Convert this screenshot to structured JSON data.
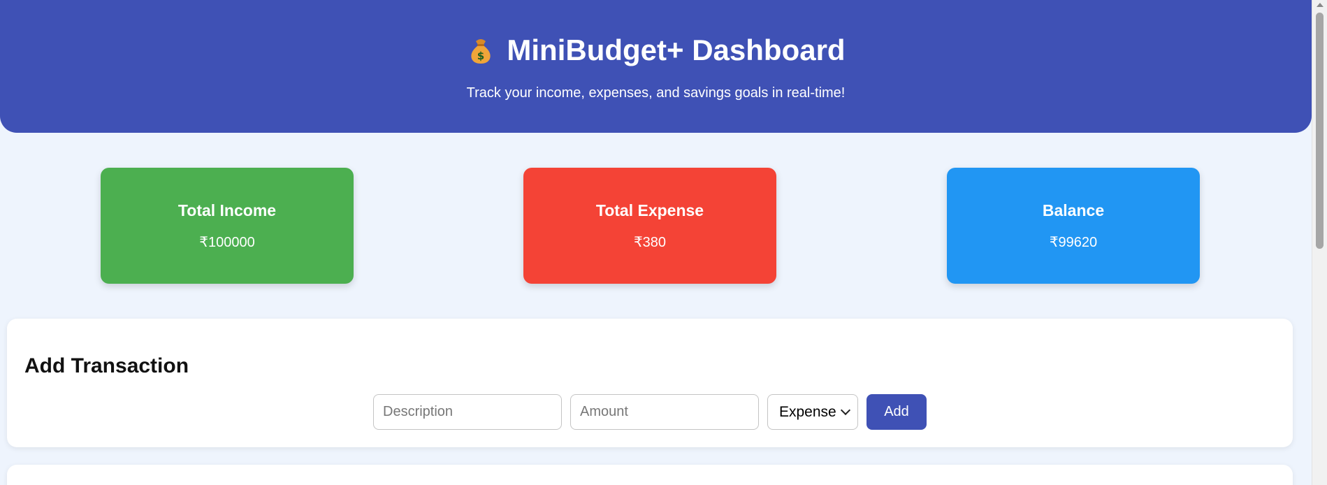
{
  "header": {
    "icon": "money-bag-icon",
    "title": "MiniBudget+ Dashboard",
    "subtitle": "Track your income, expenses, and savings goals in real-time!"
  },
  "summary": {
    "income": {
      "label": "Total Income",
      "value": "₹100000",
      "color": "#4caf50"
    },
    "expense": {
      "label": "Total Expense",
      "value": "₹380",
      "color": "#f44336"
    },
    "balance": {
      "label": "Balance",
      "value": "₹99620",
      "color": "#2196f3"
    }
  },
  "add_transaction": {
    "title": "Add Transaction",
    "description_placeholder": "Description",
    "amount_placeholder": "Amount",
    "type_selected": "Expense",
    "add_label": "Add"
  },
  "colors": {
    "accent": "#3f51b5",
    "background": "#eef4fd"
  }
}
